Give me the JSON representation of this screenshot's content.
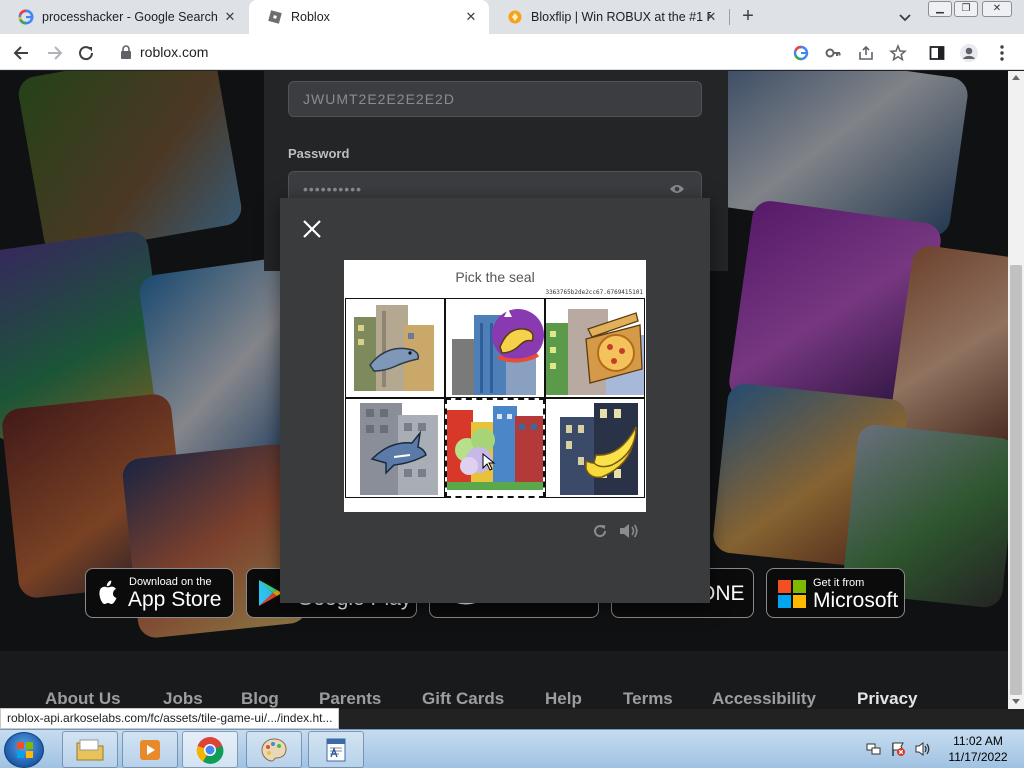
{
  "browser": {
    "tabs": [
      {
        "title": "processhacker - Google Search",
        "icon": "google-icon",
        "active": false
      },
      {
        "title": "Roblox",
        "icon": "roblox-icon",
        "active": true
      },
      {
        "title": "Bloxflip | Win ROBUX at the #1 R",
        "icon": "bloxflip-icon",
        "active": false
      }
    ],
    "url": "roblox.com"
  },
  "login": {
    "username_value": "JWUMT2E2E2E2E2D",
    "password_label": "Password",
    "password_value": "••••••••••"
  },
  "captcha": {
    "title": "Pick the seal",
    "code": "3363765b2de2cc67.6769415101",
    "tiles": [
      {
        "subject": "seal",
        "icon": "seal-icon"
      },
      {
        "subject": "rocking horse",
        "icon": "rocking-horse-icon"
      },
      {
        "subject": "pizza",
        "icon": "pizza-icon"
      },
      {
        "subject": "shark",
        "icon": "shark-icon"
      },
      {
        "subject": "flower",
        "icon": "flower-icon"
      },
      {
        "subject": "banana",
        "icon": "banana-icon"
      }
    ]
  },
  "store_badges": {
    "app_store_small": "Download on the",
    "app_store_big": "App Store",
    "google_play_big": "Google Play",
    "xbox_big": "ONE",
    "microsoft_small": "Get it from",
    "microsoft_big": "Microsoft"
  },
  "footer_links": [
    "About Us",
    "Jobs",
    "Blog",
    "Parents",
    "Gift Cards",
    "Help",
    "Terms",
    "Accessibility",
    "Privacy"
  ],
  "status_url": "roblox-api.arkoselabs.com/fc/assets/tile-game-ui/.../index.ht...",
  "taskbar": {
    "time": "11:02 AM",
    "date": "11/17/2022"
  }
}
